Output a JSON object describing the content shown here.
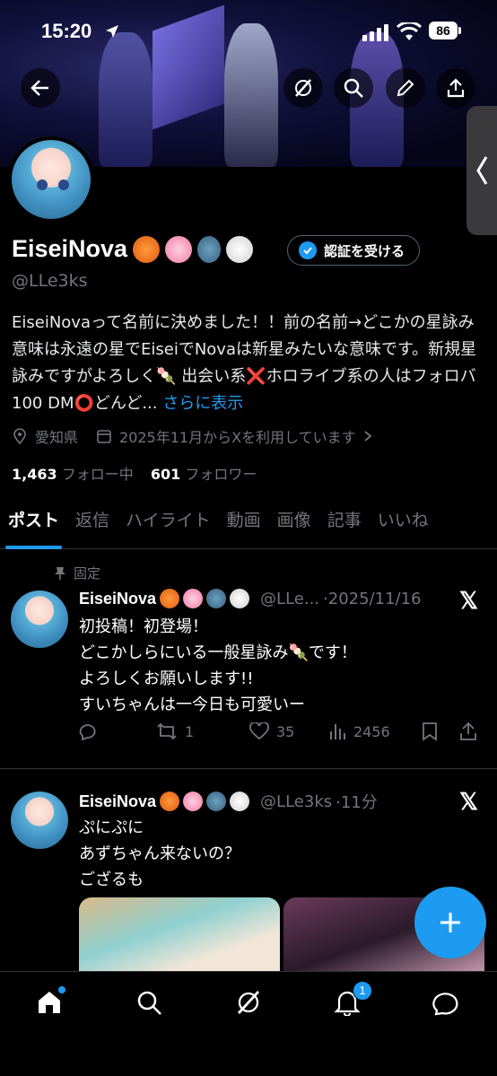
{
  "status": {
    "time": "15:20",
    "battery": "86"
  },
  "profile": {
    "name": "EiseiNova",
    "handle": "@LLe3ks",
    "verify_label": "認証を受ける",
    "bio": "EiseiNovaって名前に決めました！！前の名前→どこかの星詠み 意味は永遠の星でEiseiでNovaは新星みたいな意味です。新規星詠みですがよろしく🍡 出会い系❌ホロライブ系の人はフォロバ100 DM⭕どんど...",
    "bio_more": "さらに表示",
    "location": "愛知県",
    "joined": "2025年11月からXを利用しています",
    "following_count": "1,463",
    "following_label": "フォロー中",
    "followers_count": "601",
    "followers_label": "フォロワー"
  },
  "tabs": [
    "ポスト",
    "返信",
    "ハイライト",
    "動画",
    "画像",
    "記事",
    "いいね"
  ],
  "pinned_label": "固定",
  "tweets": [
    {
      "name": "EiseiNova",
      "handle": "@LLe...",
      "time": "·2025/11/16",
      "lines": [
        "初投稿！初登場！",
        "どこかしらにいる一般星詠み🍡です！",
        "よろしくお願いします!!",
        "すいちゃんは一今日も可愛いー"
      ],
      "retweets": "1",
      "likes": "35",
      "views": "2456"
    },
    {
      "name": "EiseiNova",
      "handle": "@LLe3ks",
      "time": "·11分",
      "lines": [
        "ぷにぷに",
        "あずちゃん来ないの？",
        "ござるも"
      ]
    }
  ],
  "nav": {
    "notif_badge": "1"
  },
  "colors": {
    "accent": "#1d9bf0",
    "background": "#000000",
    "muted": "#71767b"
  }
}
